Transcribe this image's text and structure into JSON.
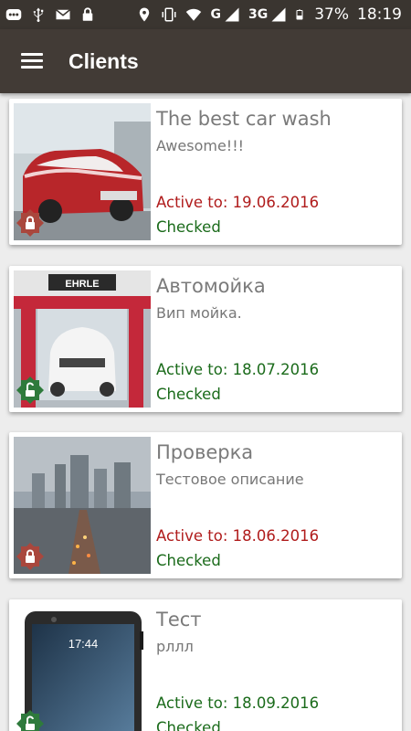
{
  "status_bar": {
    "battery": "37%",
    "time": "18:19",
    "network_1": "G",
    "network_2": "3G",
    "icons": [
      "more-icon",
      "usb-icon",
      "mail-icon",
      "lock-icon",
      "location-icon",
      "vibrate-icon",
      "wifi-icon",
      "signal-icon",
      "signal-icon",
      "battery-icon"
    ]
  },
  "app_bar": {
    "title": "Clients",
    "menu_icon": "hamburger-menu-icon"
  },
  "colors": {
    "expired": "#b01c1c",
    "active": "#1b6b1b",
    "lock_red": "#a9473d",
    "lock_green": "#2e7a3c"
  },
  "clients": [
    {
      "title": "The best car wash",
      "description": "Awesome!!!",
      "active_to": "Active to: 19.06.2016",
      "status": "Checked",
      "expired": true,
      "locked": true
    },
    {
      "title": "Автомойка",
      "description": "Вип мойка.",
      "active_to": "Active to: 18.07.2016",
      "status": "Checked",
      "expired": false,
      "locked": false
    },
    {
      "title": "Проверка",
      "description": "Тестовое описание",
      "active_to": "Active to: 18.06.2016",
      "status": "Checked",
      "expired": true,
      "locked": true
    },
    {
      "title": "Тест",
      "description": "рллл",
      "active_to": "Active to: 18.09.2016",
      "status": "Checked",
      "expired": false,
      "locked": false
    }
  ],
  "phone_clock": "17:44"
}
